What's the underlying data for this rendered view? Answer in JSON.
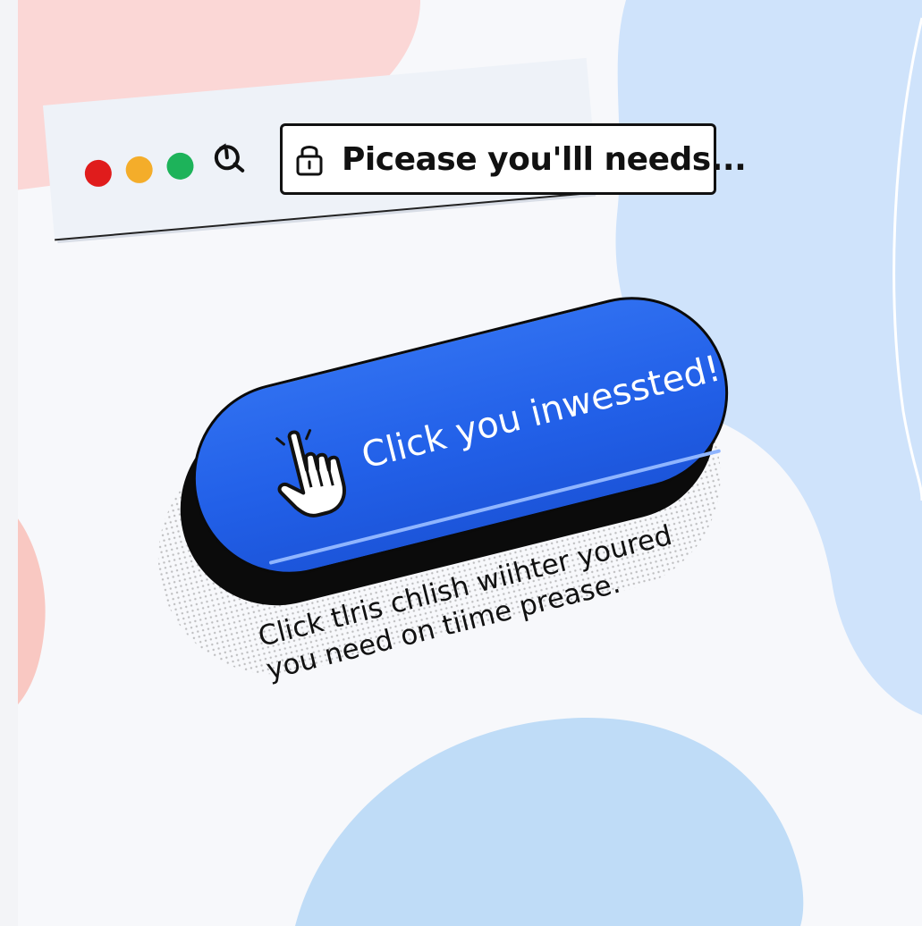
{
  "browser": {
    "window_controls": [
      "close",
      "minimize",
      "maximize"
    ],
    "reload_icon": "reload-icon",
    "lock_icon": "lock-icon",
    "address_text": "Picease you'lll needs..."
  },
  "cta": {
    "label": "Click you inwessted!",
    "cursor_icon": "hand-pointer-icon",
    "color": "#2563eb"
  },
  "caption": {
    "line1": "Click tlris chlish wiihter youred",
    "line2": "you need on tiime prease."
  },
  "colors": {
    "close": "#e01c1c",
    "minimize": "#f4ad2a",
    "maximize": "#1db35a"
  }
}
